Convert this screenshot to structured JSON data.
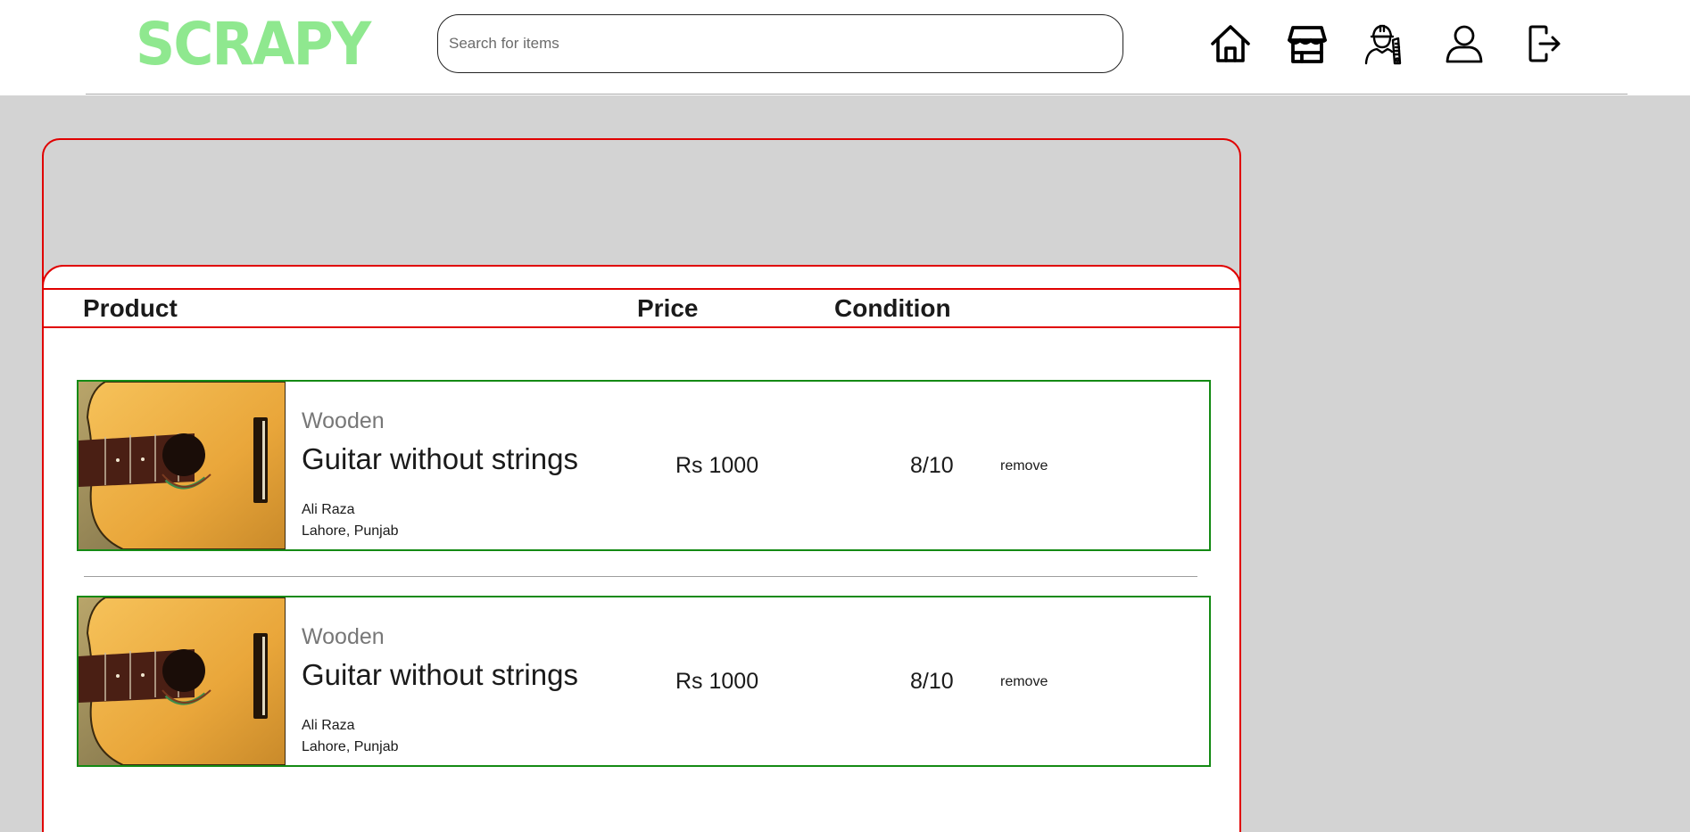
{
  "brand": {
    "logo_text": "SCRAPY",
    "logo_color": "#8fe88f"
  },
  "search": {
    "placeholder": "Search for items",
    "value": ""
  },
  "nav": [
    {
      "icon": "home-icon"
    },
    {
      "icon": "store-icon"
    },
    {
      "icon": "worker-icon"
    },
    {
      "icon": "user-icon"
    },
    {
      "icon": "logout-icon"
    }
  ],
  "cart": {
    "columns": {
      "product": "Product",
      "price": "Price",
      "condition": "Condition"
    },
    "items": [
      {
        "subtitle": "Wooden",
        "name": "Guitar without strings",
        "seller": "Ali Raza",
        "location": "Lahore, Punjab",
        "price": "Rs 1000",
        "condition": "8/10",
        "remove_label": "remove"
      },
      {
        "subtitle": "Wooden",
        "name": "Guitar without strings",
        "seller": "Ali Raza",
        "location": "Lahore, Punjab",
        "price": "Rs 1000",
        "condition": "8/10",
        "remove_label": "remove"
      }
    ]
  },
  "colors": {
    "panel_border": "#e00000",
    "item_border": "#148a14",
    "background": "#d3d3d3"
  }
}
